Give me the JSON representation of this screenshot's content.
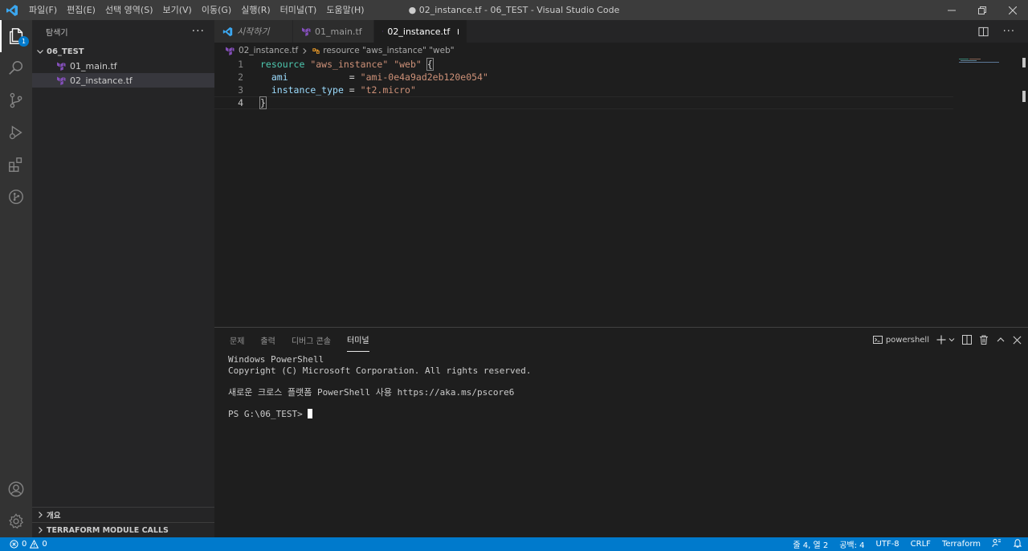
{
  "titlebar": {
    "menu": [
      "파일(F)",
      "편집(E)",
      "선택 영역(S)",
      "보기(V)",
      "이동(G)",
      "실행(R)",
      "터미널(T)",
      "도움말(H)"
    ],
    "title": "● 02_instance.tf - 06_TEST - Visual Studio Code"
  },
  "activitybar": {
    "explorer_badge": "1",
    "icons": [
      "files-icon",
      "search-icon",
      "source-control-icon",
      "run-debug-icon",
      "extensions-icon",
      "git-graph-icon",
      "account-icon",
      "settings-gear-icon"
    ]
  },
  "sidebar": {
    "header": "탐색기",
    "more": "···",
    "folder": "06_TEST",
    "files": [
      {
        "name": "01_main.tf",
        "selected": false
      },
      {
        "name": "02_instance.tf",
        "selected": true
      }
    ],
    "sections": [
      "개요",
      "TERRAFORM MODULE CALLS"
    ]
  },
  "tabs": [
    {
      "label": "시작하기",
      "italic": true,
      "active": false
    },
    {
      "label": "01_main.tf",
      "active": false
    },
    {
      "label": "02_instance.tf",
      "active": true,
      "dirty": true
    }
  ],
  "breadcrumb": {
    "file": "02_instance.tf",
    "symbol": "resource \"aws_instance\" \"web\""
  },
  "code": {
    "line_numbers": [
      "1",
      "2",
      "3",
      "4"
    ],
    "l1_kw": "resource",
    "l1_s1": "\"aws_instance\"",
    "l1_s2": "\"web\"",
    "l1_brace": "{",
    "l2_attr": "ami",
    "l2_eq": "           = ",
    "l2_val": "\"ami-0e4a9ad2eb120e054\"",
    "l3_attr": "instance_type",
    "l3_eq": " = ",
    "l3_val": "\"t2.micro\"",
    "l4_brace": "}"
  },
  "panel": {
    "tabs": [
      "문제",
      "출력",
      "디버그 콘솔",
      "터미널"
    ],
    "active_tab": "터미널",
    "terminal_name": "powershell",
    "terminal_lines": [
      "Windows PowerShell",
      "Copyright (C) Microsoft Corporation. All rights reserved.",
      "",
      "새로운 크로스 플랫폼 PowerShell 사용 https://aka.ms/pscore6",
      ""
    ],
    "prompt": "PS G:\\06_TEST> "
  },
  "statusbar": {
    "errors": "0",
    "warnings": "0",
    "position": "줄 4, 열 2",
    "spaces": "공백: 4",
    "encoding": "UTF-8",
    "eol": "CRLF",
    "language": "Terraform"
  },
  "colors": {
    "accent": "#007acc",
    "terraform_icon": "#844fba",
    "keyword": "#4ec9b0",
    "string": "#ce9178",
    "attribute": "#9cdcfe"
  }
}
